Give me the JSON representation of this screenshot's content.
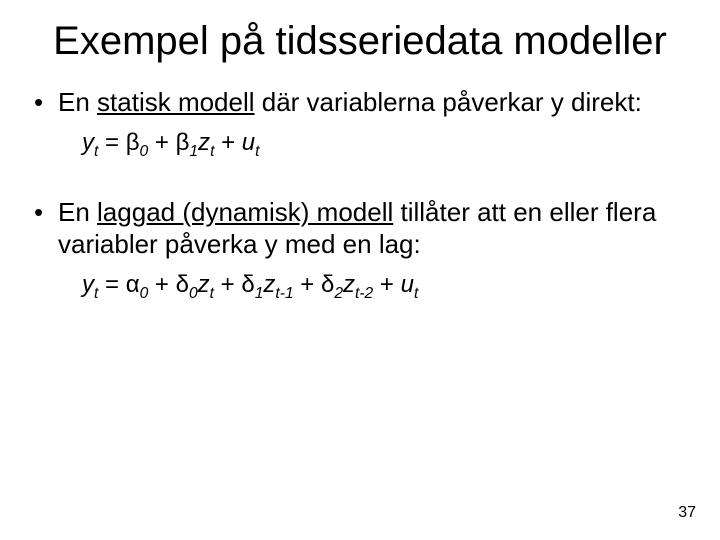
{
  "title": "Exempel på tidsseriedata modeller",
  "bullet1": {
    "pre": "En ",
    "underlined": "statisk modell",
    "post": " där variablerna påverkar y direkt:"
  },
  "eq1": {
    "lhs_var": "y",
    "lhs_sub": "t",
    "eq": " = ",
    "b": "β",
    "sub0": "0",
    "plus": " + ",
    "sub1": "1",
    "z": "z",
    "zsub": "t",
    "u": "u",
    "usub": "t"
  },
  "bullet2": {
    "pre": "En ",
    "underlined": "laggad (dynamisk) modell",
    "post": " tillåter att en eller flera variabler påverka y med en lag:"
  },
  "eq2": {
    "y": "y",
    "ysub": "t",
    "eq": " = ",
    "alpha": "α",
    "a0": "0",
    "plus": " + ",
    "delta": "δ",
    "d0": "0",
    "z": "z",
    "zt": "t",
    "d1": "1",
    "zt1": "t-1",
    "d2": "2",
    "zt2": "t-2",
    "u": "u",
    "usub": "t"
  },
  "page": "37"
}
